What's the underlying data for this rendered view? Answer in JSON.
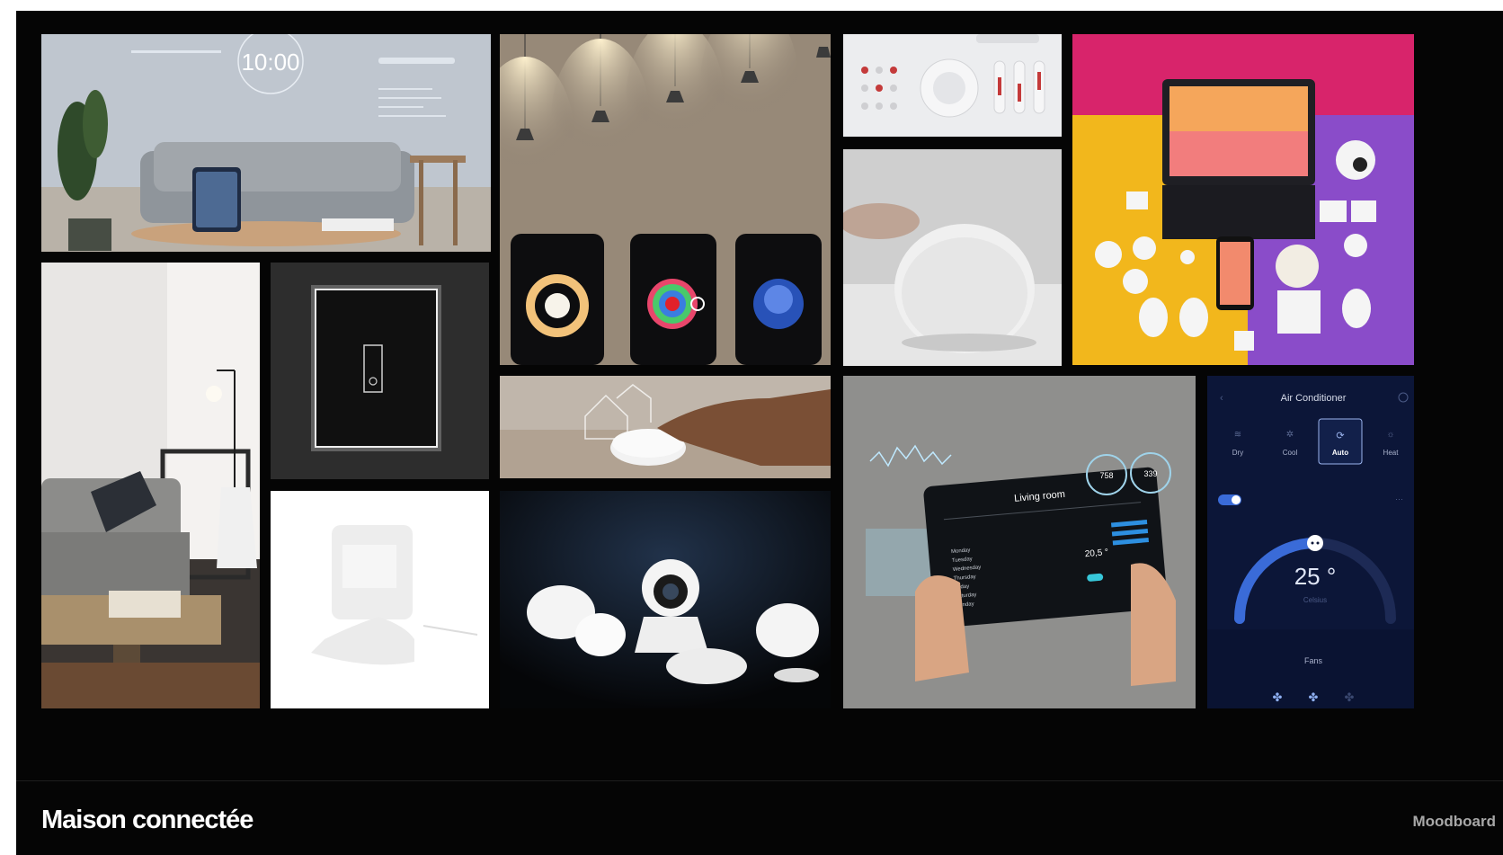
{
  "board": {
    "title": "Maison connectée",
    "label": "Moodboard"
  },
  "living_room_tablet": {
    "clock": "10:00"
  },
  "phones": {
    "screen_count": 3
  },
  "living_room_app": {
    "header": "Living room",
    "setpoint": "20,5 °",
    "readouts": [
      "758",
      "339"
    ],
    "days": [
      "Monday",
      "Tuesday",
      "Wednesday",
      "Thursday",
      "Friday",
      "Saturday",
      "Sunday"
    ]
  },
  "ac_app": {
    "title": "Air Conditioner",
    "modes": [
      "Dry",
      "Cool",
      "Auto",
      "Heat"
    ],
    "active_mode": "Auto",
    "temperature": "25 °",
    "unit": "Celsius",
    "fans_label": "Fans"
  },
  "colors": {
    "background": "#050505",
    "accent_blue": "#3a6bd8",
    "ac_panel": "#0c1638",
    "title_text": "#ffffff",
    "label_text": "#a8a8a8"
  }
}
